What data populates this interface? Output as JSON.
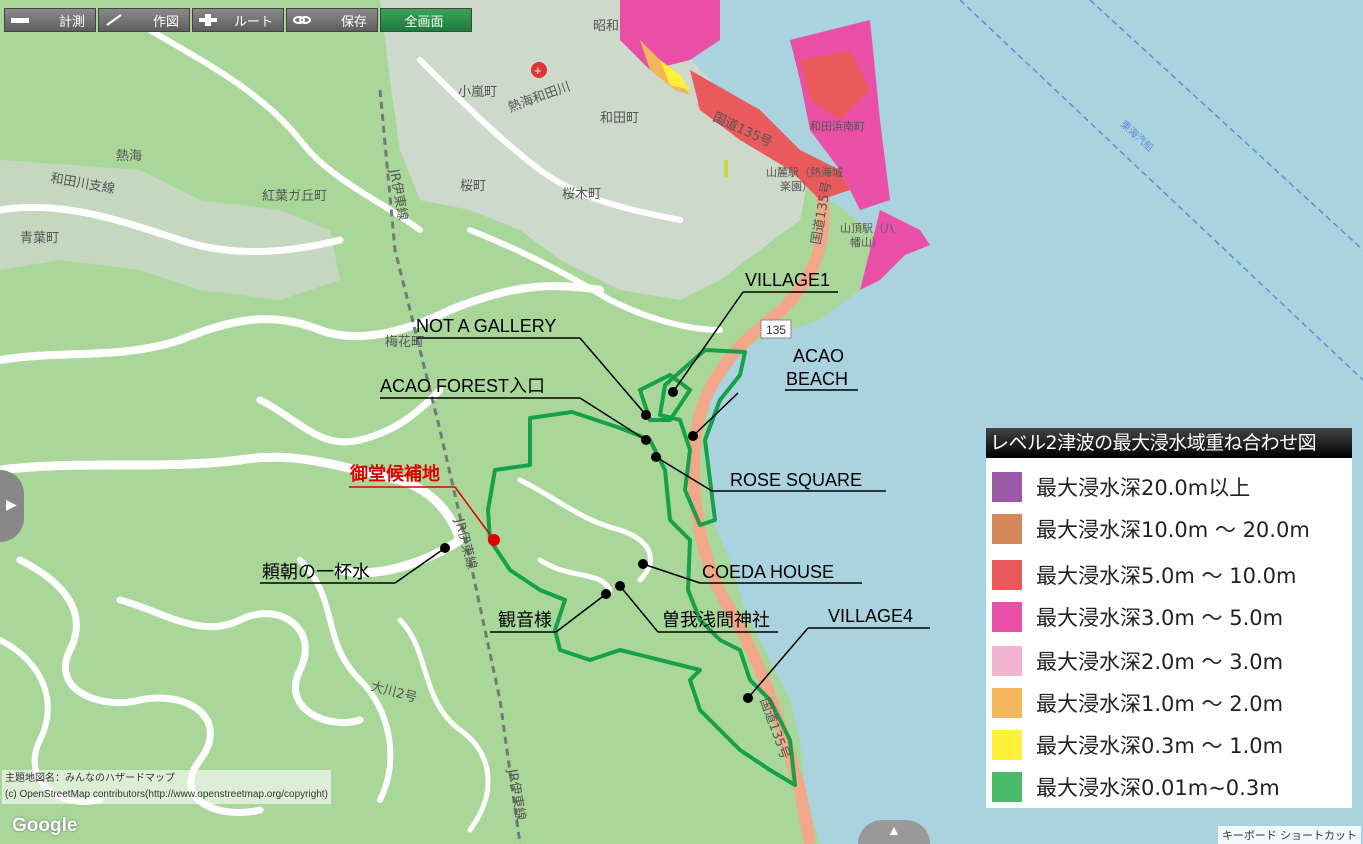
{
  "toolbar": {
    "measure": "計測",
    "draw": "作図",
    "route": "ルート",
    "save": "保存",
    "fullscreen": "全画面"
  },
  "map_labels": {
    "showa": "昭和",
    "kozakicho": "小嵐町",
    "atami_wadagawa": "熱海和田川",
    "wadacho": "和田町",
    "atami": "熱海",
    "wadagawa_branch": "和田川支線",
    "koyogaoka": "紅葉ガ丘町",
    "sakuramachi": "桜町",
    "sakuragicho": "桜木町",
    "aobacho": "青葉町",
    "baikacho": "梅花町",
    "route135": "国道135号",
    "route135_b": "国道135号",
    "route135_c": "国道135号",
    "shield135": "135",
    "jr_ito_1": "JR伊東線",
    "jr_ito_2": "JR伊東線",
    "jr_ito_3": "JR伊東線",
    "ookawa2": "大川2号",
    "sanroku": "山麓駅（熱海城",
    "sanroku_b": "楽園）",
    "sancho": "山頂駅（八",
    "sancho_b": "幡山）",
    "wadahama": "和田浜南町",
    "tokai_kisen": "東海汽船"
  },
  "annotations": {
    "village1": "VILLAGE1",
    "not_a_gallery": "NOT A GALLERY",
    "acao_forest": "ACAO FOREST入口",
    "acao_beach_1": "ACAO",
    "acao_beach_2": "BEACH",
    "rose_square": "ROSE SQUARE",
    "candidate": "御堂候補地",
    "yoritomo": "頼朝の一杯水",
    "coeda_house": "COEDA HOUSE",
    "kannon": "観音様",
    "soga": "曽我浅間神社",
    "village4": "VILLAGE4"
  },
  "legend": {
    "title": "レベル2津波の最大浸水域重ね合わせ図",
    "items": [
      {
        "label": "最大浸水深20.0m以上",
        "color": "#9b5aa6"
      },
      {
        "label": "最大浸水深10.0m ～ 20.0m",
        "color": "#d4875a"
      },
      {
        "label": "最大浸水深5.0m ～ 10.0m",
        "color": "#ea5a5c"
      },
      {
        "label": "最大浸水深3.0m ～ 5.0m",
        "color": "#ea4fa8"
      },
      {
        "label": "最大浸水深2.0m ～ 3.0m",
        "color": "#f0b3d0"
      },
      {
        "label": "最大浸水深1.0m ～ 2.0m",
        "color": "#f3b65a"
      },
      {
        "label": "最大浸水深0.3m ～ 1.0m",
        "color": "#fff03a"
      },
      {
        "label": "最大浸水深0.01m~0.3m",
        "color": "#4cbb6c"
      }
    ]
  },
  "attribution": {
    "line1": "主題地図名：みんなのハザードマップ",
    "line2": "(c) OpenStreetMap contributors(http://www.openstreetmap.org/copyright)"
  },
  "google": "Google",
  "keyboard": "キーボード ショートカット",
  "colors": {
    "land": "#a9d79a",
    "sea": "#aad3df",
    "road": "#ffffff",
    "route": "#f2a68a",
    "outline": "#17a04a",
    "candidate": "#e00000"
  }
}
